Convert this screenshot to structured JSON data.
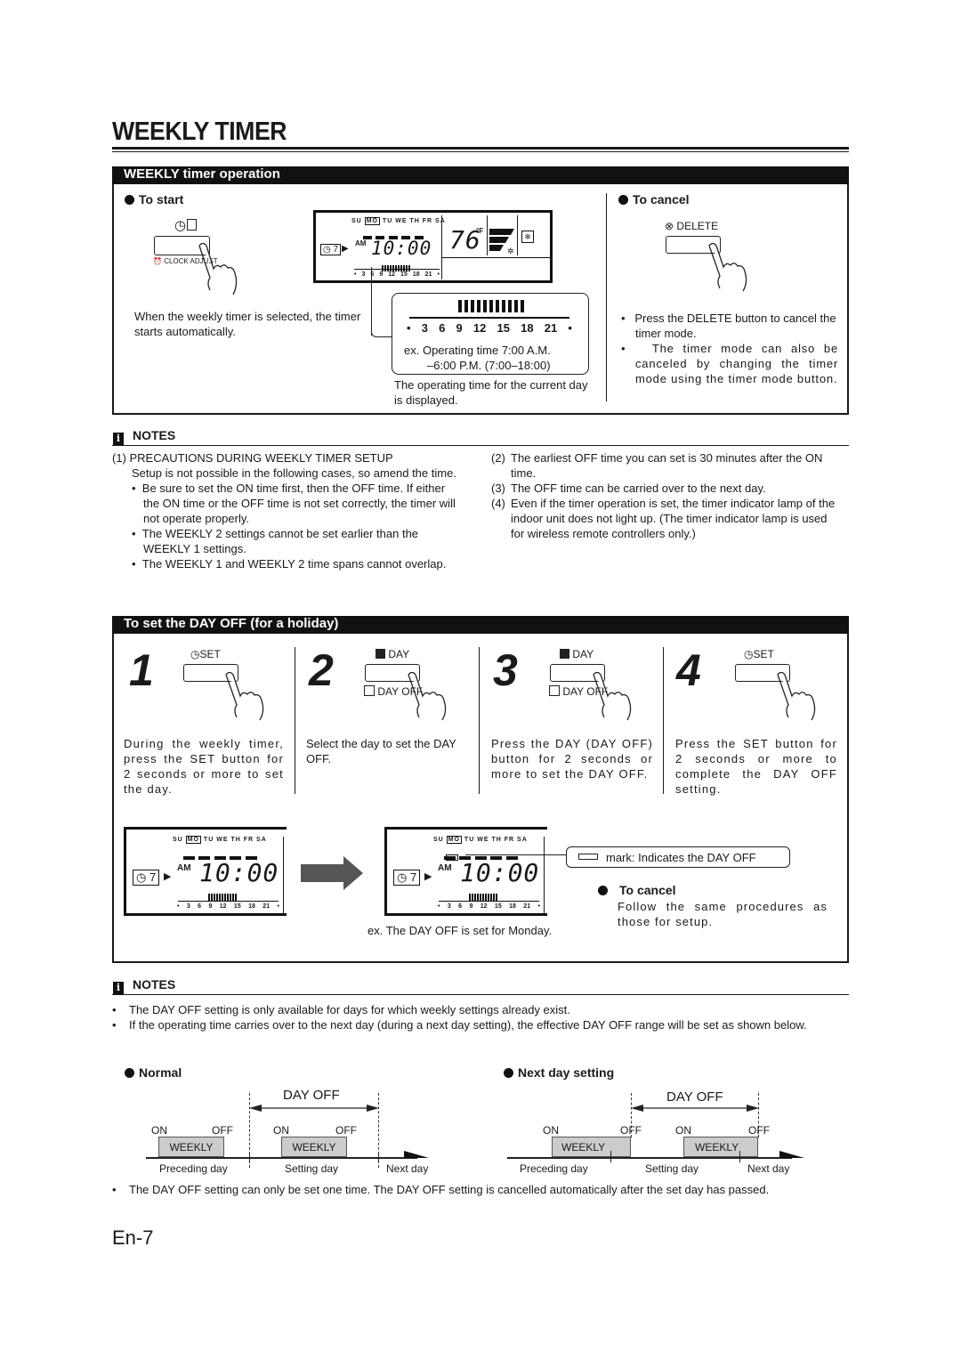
{
  "page": {
    "title": "WEEKLY TIMER",
    "page_number": "En-7"
  },
  "operation": {
    "header": "WEEKLY timer operation",
    "to_start": {
      "label": "To start",
      "button_label": "CLOCK ADJUST",
      "description": "When the weekly timer is selected, the timer starts automatically."
    },
    "lcd": {
      "days": [
        "SU",
        "MO",
        "TU",
        "WE",
        "TH",
        "FR",
        "SA"
      ],
      "selected_day": "MO",
      "timer_label": "7",
      "ampm": "AM",
      "time": "10:00",
      "temperature": "76",
      "temp_unit": "°F",
      "ticks": [
        "•",
        "3",
        "6",
        "9",
        "12",
        "15",
        "18",
        "21",
        "•"
      ]
    },
    "zoom_callout": {
      "ticks": [
        "•",
        "3",
        "6",
        "9",
        "12",
        "15",
        "18",
        "21",
        "•"
      ],
      "example_line1": "ex.  Operating time 7:00 A.M.",
      "example_line2": "–6:00 P.M. (7:00–18:00)",
      "caption": "The operating time for the current day is displayed."
    },
    "to_cancel": {
      "label": "To cancel",
      "button_label": "DELETE",
      "bullets": [
        "Press the DELETE button to cancel the timer mode.",
        "The timer mode can also be canceled by changing the timer mode using the timer mode button."
      ]
    }
  },
  "notes1": {
    "header": "NOTES",
    "item1_title": "(1) PRECAUTIONS DURING WEEKLY TIMER SETUP",
    "item1_body": "Setup is not possible in the following cases, so amend the time.",
    "item1_bullets": [
      "Be sure to set the ON time first, then the OFF time. If either the ON time or the OFF time is not set correctly, the timer will not operate properly.",
      "The WEEKLY 2 settings cannot be set earlier than the WEEKLY 1 settings.",
      "The WEEKLY 1 and WEEKLY 2 time spans cannot overlap."
    ],
    "item2_num": "(2)",
    "item2": "The earliest OFF time you can set is 30 minutes after the ON time.",
    "item3_num": "(3)",
    "item3": "The OFF time can be carried over to the next day.",
    "item4_num": "(4)",
    "item4": "Even if the timer operation is set, the timer indicator lamp of the indoor unit does not light up. (The timer indicator lamp is used for wireless remote controllers only.)"
  },
  "dayoff": {
    "header": "To set the DAY OFF (for a holiday)",
    "steps": [
      {
        "num": "1",
        "button_top": "SET",
        "button_bottom": "",
        "text": "During the weekly timer, press the SET button for 2 seconds or more to set the day."
      },
      {
        "num": "2",
        "button_top": "DAY",
        "button_bottom": "DAY OFF",
        "text": "Select the day to set the DAY OFF."
      },
      {
        "num": "3",
        "button_top": "DAY",
        "button_bottom": "DAY OFF",
        "text": "Press the DAY (DAY OFF) button for 2 seconds or more to set the DAY OFF."
      },
      {
        "num": "4",
        "button_top": "SET",
        "button_bottom": "",
        "text": "Press the SET button for 2 seconds or more to complete the DAY OFF setting."
      }
    ],
    "mark_callout": "mark: Indicates the DAY OFF",
    "example_caption": "ex. The DAY OFF is set for Monday.",
    "to_cancel_label": "To cancel",
    "to_cancel_text": "Follow the same procedures as those for setup."
  },
  "notes2": {
    "header": "NOTES",
    "bullets": [
      "The DAY OFF setting is only available for days for which weekly settings already exist.",
      "If the operating time carries over to the next day (during a next day setting), the effective DAY OFF range will be set as shown below."
    ],
    "final_bullet": "The DAY OFF setting can only be set one time. The DAY OFF setting is cancelled automatically after the set day has passed."
  },
  "diagrams": {
    "normal": {
      "label": "Normal",
      "dayoff": "DAY OFF",
      "on": "ON",
      "off": "OFF",
      "weekly": "WEEKLY",
      "days": [
        "Preceding day",
        "Setting day",
        "Next day"
      ]
    },
    "next_day": {
      "label": "Next day setting",
      "dayoff": "DAY OFF",
      "on": "ON",
      "off": "OFF",
      "weekly": "WEEKLY",
      "days": [
        "Preceding day",
        "Setting day",
        "Next day"
      ]
    }
  }
}
